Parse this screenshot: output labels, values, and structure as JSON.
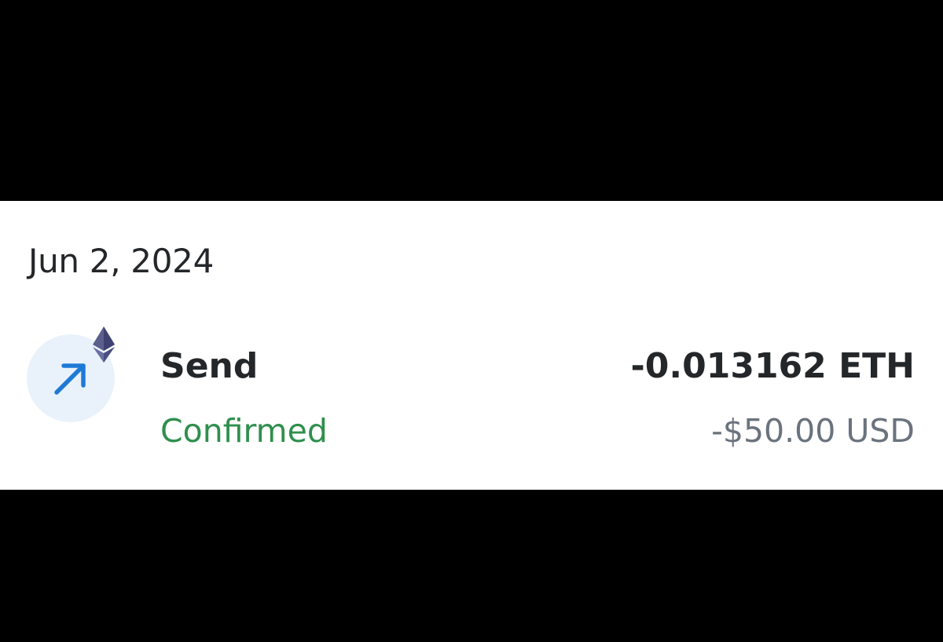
{
  "activity": {
    "date_header": "Jun 2, 2024",
    "transaction": {
      "title": "Send",
      "status": "Confirmed",
      "amount": "-0.013162 ETH",
      "fiat_amount": "-$50.00 USD",
      "icon": "arrow-up-right-icon",
      "badge_icon": "ethereum-icon",
      "colors": {
        "status": "#2f8f4e",
        "icon_accent": "#1f7ad6",
        "icon_background": "#e9f2fb"
      }
    }
  }
}
